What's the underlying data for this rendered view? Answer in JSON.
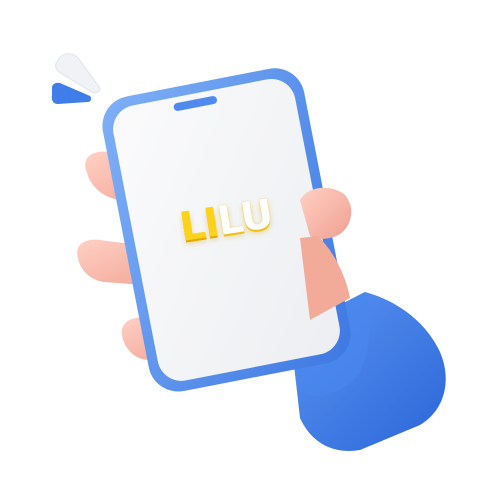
{
  "logo": {
    "part1": "LI",
    "part2": "LU"
  },
  "colors": {
    "logo_yellow": "#ffd21a",
    "phone_frame_blue": "#4f8bee",
    "phone_screen": "#f3f4f6",
    "sleeve_blue": "#3c7ae8",
    "skin": "#f4b3a4",
    "background": "#ffffff"
  },
  "icons": [
    "hand-holding-phone",
    "notification-burst-marks"
  ]
}
